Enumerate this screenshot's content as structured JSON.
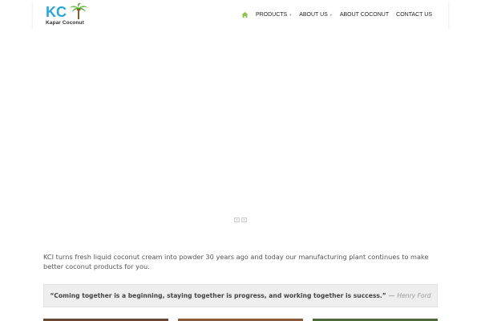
{
  "header": {
    "logo": {
      "mark_text": "KC",
      "name": "Kapar Coconut"
    },
    "nav": {
      "home_icon": "home-icon",
      "items": [
        {
          "label": "PRODUCTS",
          "has_dropdown": true
        },
        {
          "label": "ABOUT US",
          "has_dropdown": true
        },
        {
          "label": "ABOUT COCONUT",
          "has_dropdown": false
        },
        {
          "label": "CONTACT US",
          "has_dropdown": false
        }
      ]
    }
  },
  "slider": {
    "prev_label": "‹",
    "next_label": "›"
  },
  "intro": {
    "text": "KCI turns fresh liquid coconut cream into powder 30 years ago and today our manufacturing plant continues to make better coconut products for you."
  },
  "quote": {
    "text": "“Coming together is a beginning, staying together is progress, and working together is success.”",
    "separator": "—",
    "author": "Henry Ford"
  },
  "colors": {
    "accent": "#8bc34a",
    "nav_text": "#222222",
    "quote_bg": "#eeeeee"
  }
}
